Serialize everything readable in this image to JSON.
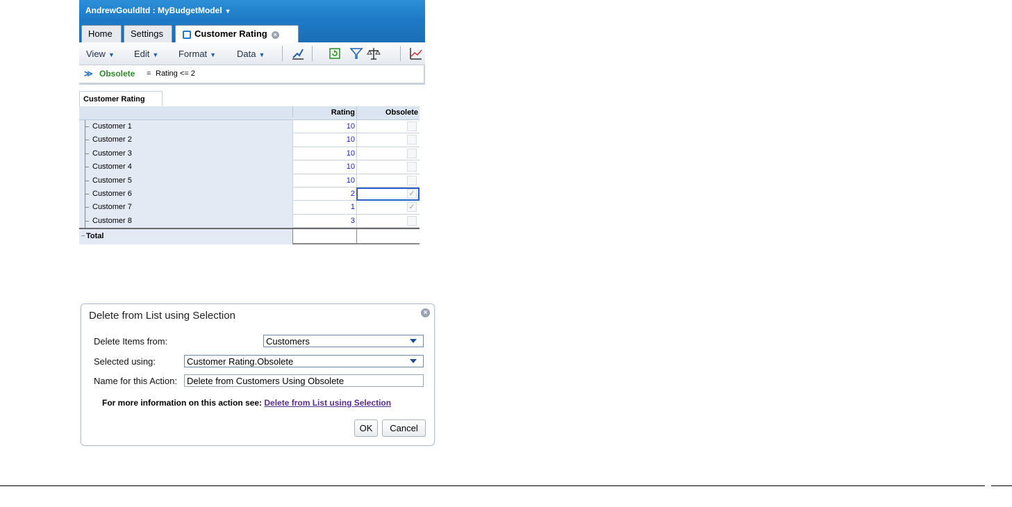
{
  "app": {
    "title": "AndrewGouldltd : MyBudgetModel",
    "tabs": [
      {
        "label": "Home"
      },
      {
        "label": "Settings"
      },
      {
        "label": "Customer Rating"
      }
    ],
    "menus": [
      {
        "label": "View"
      },
      {
        "label": "Edit"
      },
      {
        "label": "Format"
      },
      {
        "label": "Data"
      }
    ],
    "formula": {
      "name": "Obsolete",
      "eq": "=",
      "expr": "Rating <= 2"
    }
  },
  "grid": {
    "tab_label": "Customer Rating",
    "columns": [
      "Rating",
      "Obsolete"
    ],
    "rows": [
      {
        "label": "Customer 1",
        "rating": "10",
        "obsolete": ""
      },
      {
        "label": "Customer 2",
        "rating": "10",
        "obsolete": ""
      },
      {
        "label": "Customer 3",
        "rating": "10",
        "obsolete": ""
      },
      {
        "label": "Customer 4",
        "rating": "10",
        "obsolete": ""
      },
      {
        "label": "Customer 5",
        "rating": "10",
        "obsolete": ""
      },
      {
        "label": "Customer 6",
        "rating": "2",
        "obsolete": "✓"
      },
      {
        "label": "Customer 7",
        "rating": "1",
        "obsolete": "✓"
      },
      {
        "label": "Customer 8",
        "rating": "3",
        "obsolete": ""
      }
    ],
    "total_label": "Total"
  },
  "dialog": {
    "title": "Delete from List using Selection",
    "delete_from_label": "Delete Items from:",
    "delete_from_value": "Customers",
    "selected_using_label": "Selected using:",
    "selected_using_value": "Customer Rating.Obsolete",
    "name_label": "Name for this Action:",
    "name_value": "Delete from Customers Using Obsolete",
    "info_text": "For more information on this action see:",
    "info_link": "Delete from List using Selection",
    "ok_label": "OK",
    "cancel_label": "Cancel"
  },
  "colors": {
    "accent": "#1e7ac6",
    "selection": "#2f5fc7",
    "formula_name": "#2d8a2d",
    "link": "#5a2d8a"
  }
}
